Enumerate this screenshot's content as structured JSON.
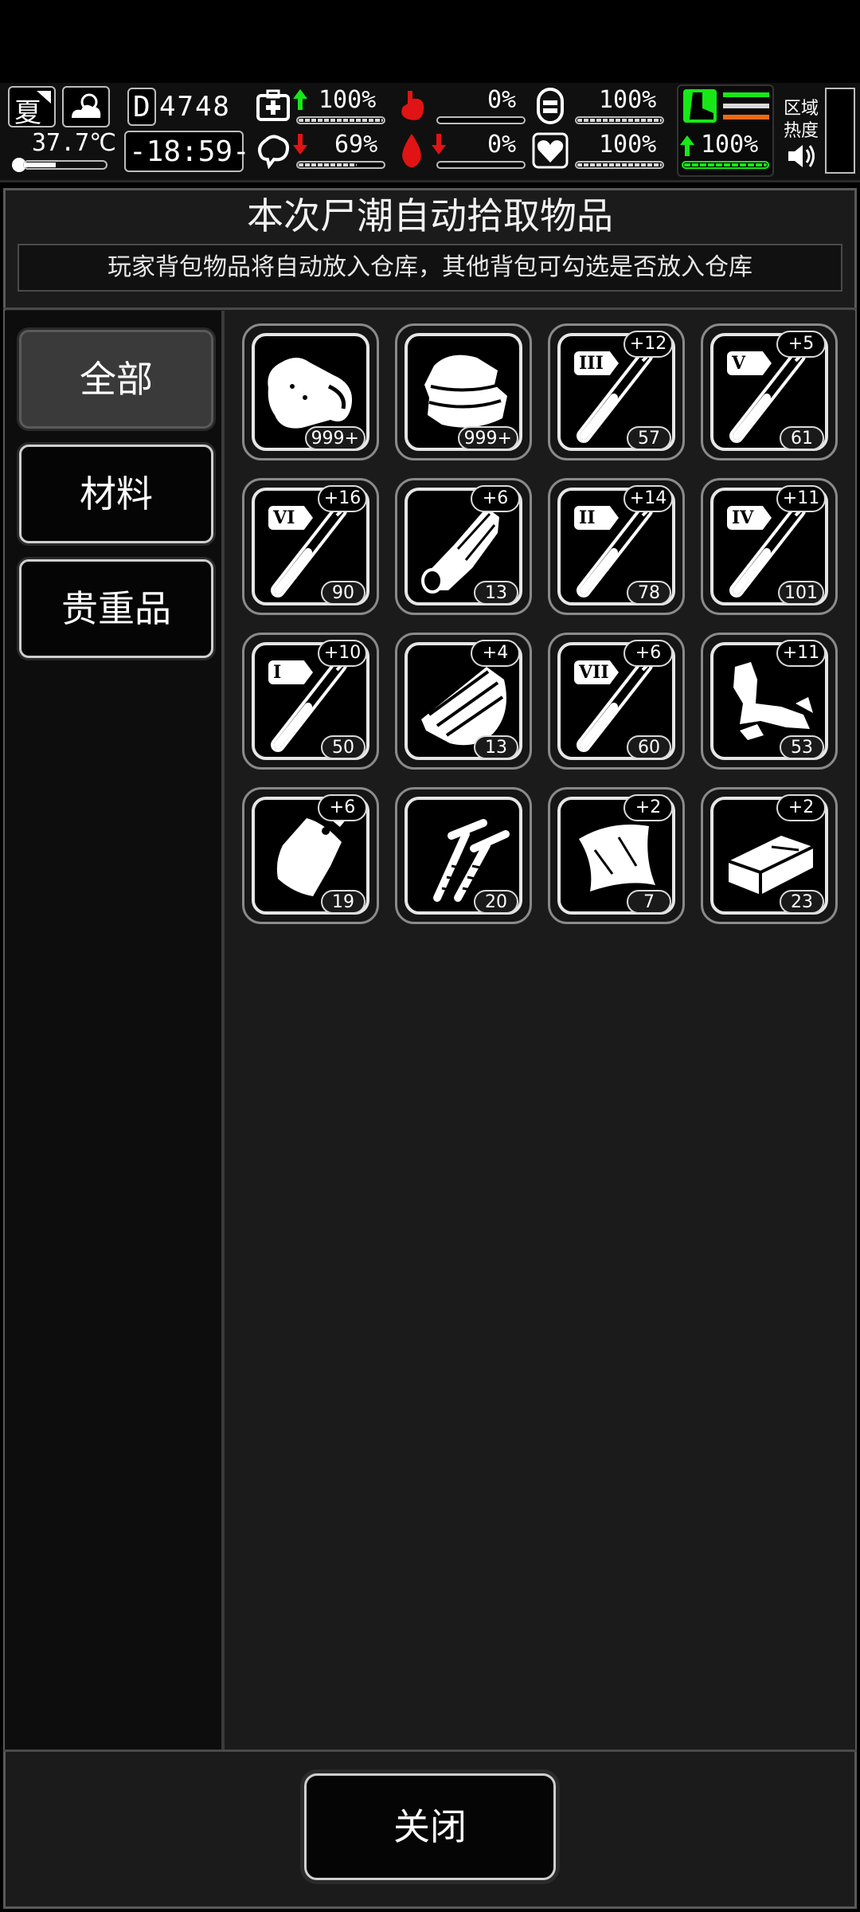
{
  "hud": {
    "season": "夏",
    "temperature": "37.7℃",
    "day_prefix": "D",
    "day_number": "4748",
    "time": "-18:59-",
    "health_pct": "100%",
    "hunger_pct": "0%",
    "stamina_pct": "100%",
    "sanity_pct": "69%",
    "thirst_pct": "0%",
    "heart_pct": "100%",
    "speed_pct": "100%",
    "zone_label_1": "区域",
    "zone_label_2": "热度",
    "health_fill": 1.0,
    "hunger_fill": 0.0,
    "stamina_fill": 1.0,
    "sanity_fill": 0.69,
    "thirst_fill": 0.0,
    "heart_fill": 1.0,
    "speed_fill": 1.0,
    "colors": {
      "green": "#18e818",
      "red": "#e01414",
      "orange": "#f06a10"
    }
  },
  "panel": {
    "title": "本次尸潮自动拾取物品",
    "subtitle": "玩家背包物品将自动放入仓库，其他背包可勾选是否放入仓库"
  },
  "categories": [
    {
      "label": "全部",
      "active": true
    },
    {
      "label": "材料",
      "active": false
    },
    {
      "label": "贵重品",
      "active": false
    }
  ],
  "items": [
    {
      "icon": "meat-icon",
      "count": "999+",
      "plus": ""
    },
    {
      "icon": "cloth-icon",
      "count": "999+",
      "plus": ""
    },
    {
      "icon": "syringe-icon",
      "tier": "III",
      "count": "57",
      "plus": "+12"
    },
    {
      "icon": "syringe-icon",
      "tier": "V",
      "count": "61",
      "plus": "+5"
    },
    {
      "icon": "syringe-icon",
      "tier": "VI",
      "count": "90",
      "plus": "+16"
    },
    {
      "icon": "wood-log-icon",
      "count": "13",
      "plus": "+6"
    },
    {
      "icon": "syringe-icon",
      "tier": "II",
      "count": "78",
      "plus": "+14"
    },
    {
      "icon": "syringe-icon",
      "tier": "IV",
      "count": "101",
      "plus": "+11"
    },
    {
      "icon": "syringe-icon",
      "tier": "I",
      "count": "50",
      "plus": "+10"
    },
    {
      "icon": "wood-planks-icon",
      "count": "13",
      "plus": "+4"
    },
    {
      "icon": "syringe-icon",
      "tier": "VII",
      "count": "60",
      "plus": "+6"
    },
    {
      "icon": "scrap-metal-icon",
      "count": "53",
      "plus": "+11"
    },
    {
      "icon": "bag-icon",
      "count": "19",
      "plus": "+6"
    },
    {
      "icon": "nails-icon",
      "count": "20",
      "plus": ""
    },
    {
      "icon": "sheet-icon",
      "count": "7",
      "plus": "+2"
    },
    {
      "icon": "brick-icon",
      "count": "23",
      "plus": "+2"
    }
  ],
  "close_label": "关闭"
}
